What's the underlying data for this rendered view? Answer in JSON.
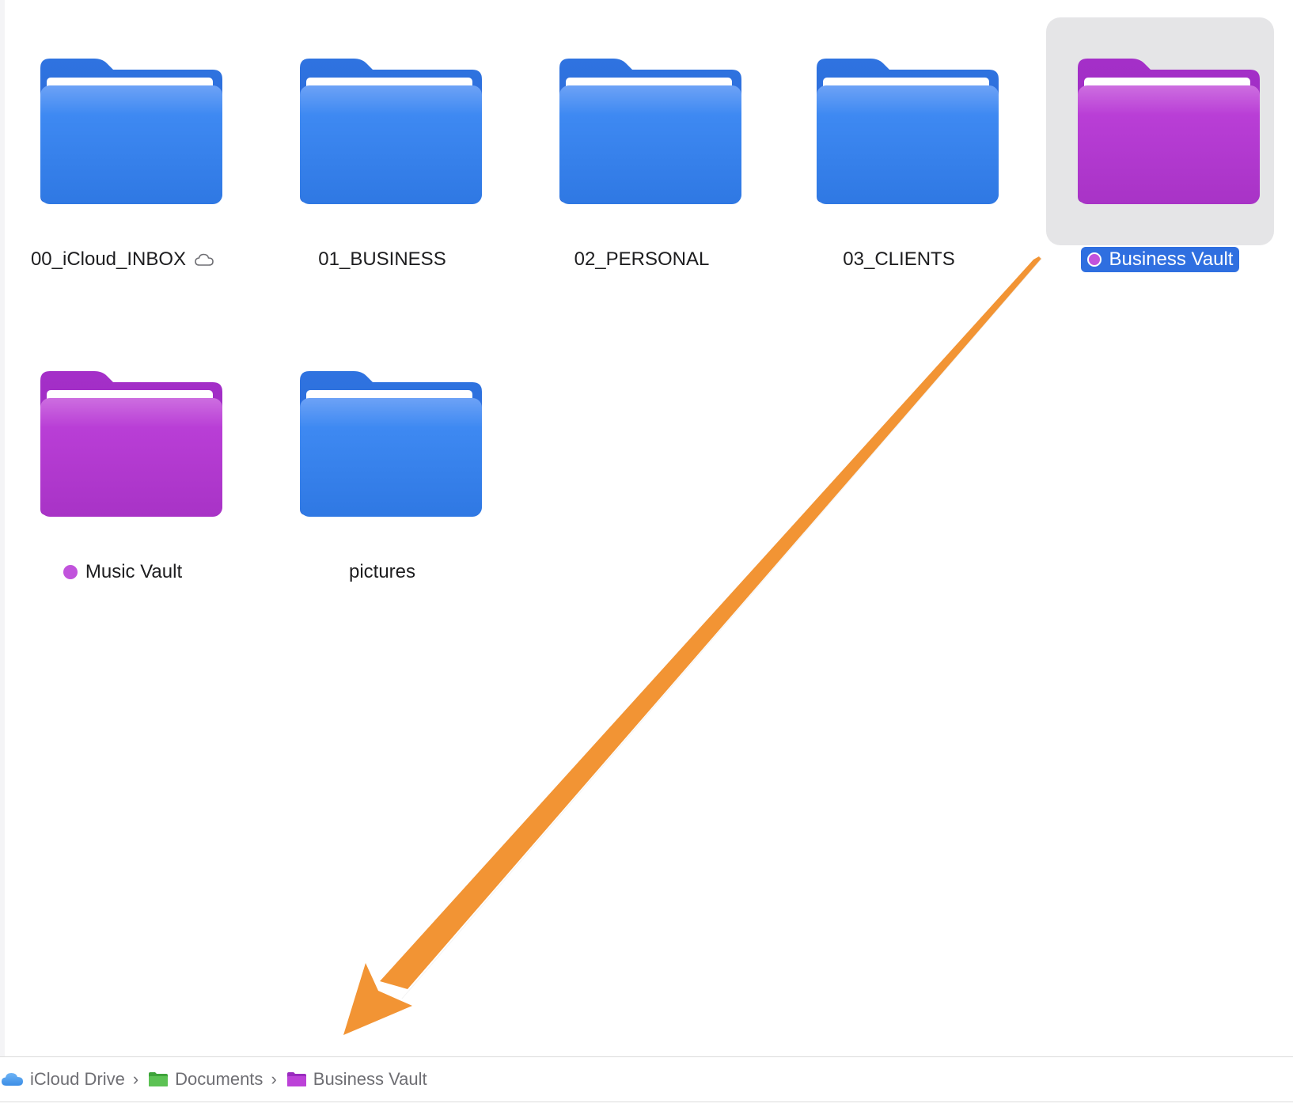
{
  "folders": [
    {
      "name": "00_iCloud_INBOX",
      "color": "blue",
      "cloud_icon": "cloud-outline-icon"
    },
    {
      "name": "01_BUSINESS",
      "color": "blue"
    },
    {
      "name": "02_PERSONAL",
      "color": "blue"
    },
    {
      "name": "03_CLIENTS",
      "color": "blue"
    },
    {
      "name": "Business Vault",
      "color": "purple",
      "tag": "purple",
      "selected": true
    },
    {
      "name": "Music Vault",
      "color": "purple",
      "tag": "purple"
    },
    {
      "name": "pictures",
      "color": "blue"
    }
  ],
  "colors": {
    "folder_blue": "#3b86f0",
    "folder_purple": "#b43bd3",
    "tag_purple": "#c153dc",
    "selection_blue": "#2f6fe0",
    "arrow_orange": "#f29434"
  },
  "annotation": {
    "type": "arrow",
    "icon": "orange-arrow-annotation",
    "from": "Business Vault",
    "to": "path-bar"
  },
  "path_bar": {
    "items": [
      {
        "label": "iCloud Drive",
        "icon": "icloud-icon"
      },
      {
        "label": "Documents",
        "icon": "green-folder-icon"
      },
      {
        "label": "Business Vault",
        "icon": "purple-folder-icon"
      }
    ],
    "separator": "›"
  }
}
